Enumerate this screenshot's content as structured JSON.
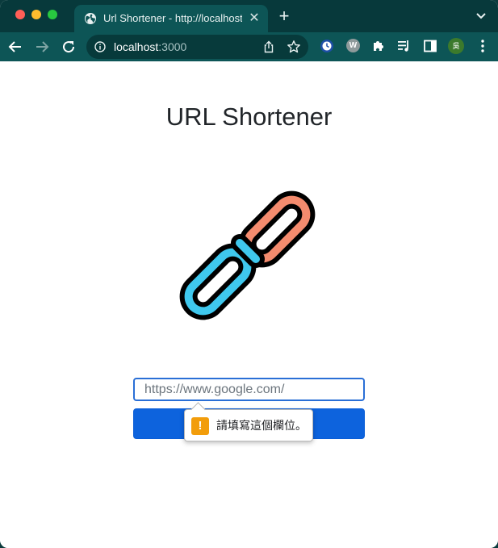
{
  "browser": {
    "tab": {
      "title": "Url Shortener - http://localhost",
      "favicon": "globe-icon"
    },
    "address_bar": {
      "host": "localhost",
      "port": ":3000"
    },
    "extensions": [
      "clock-extension-icon",
      "w-extension-icon",
      "puzzle-icon",
      "reading-list-icon",
      "side-panel-icon"
    ],
    "w_extension_letter": "W",
    "profile_initial": "吳"
  },
  "page": {
    "title": "URL Shortener",
    "logo": "chain-link-icon",
    "input": {
      "placeholder": "https://www.google.com/",
      "value": ""
    },
    "validation_tooltip": {
      "icon": "warning-icon",
      "icon_glyph": "!",
      "message": "請填寫這個欄位。"
    }
  },
  "colors": {
    "frame": "#07393b",
    "toolbar": "#0d5556",
    "primary_button": "#0d63dd",
    "input_focus_border": "#2a6fd6",
    "chain_coral": "#f48b6e",
    "chain_cyan": "#3fc8ee",
    "warning": "#f29d0b"
  }
}
